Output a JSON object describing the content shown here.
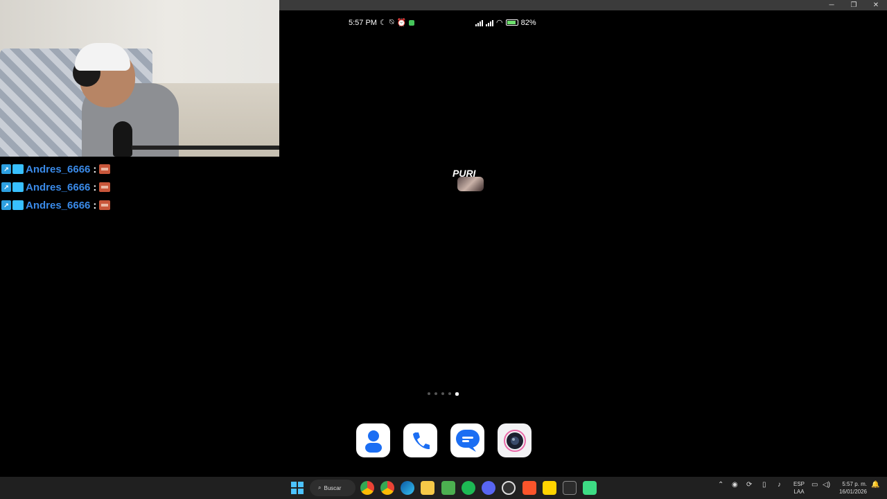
{
  "chat": {
    "messages": [
      {
        "user": "Andres_6666",
        "separator": ":"
      },
      {
        "user": "Andres_6666",
        "separator": ":"
      },
      {
        "user": "Andres_6666",
        "separator": ":"
      }
    ]
  },
  "window": {
    "minimize": "─",
    "restore": "❐",
    "close": "✕"
  },
  "phone_status": {
    "time": "5:57 PM",
    "battery": "82"
  },
  "widget": {
    "text": "PURI"
  },
  "home_pages": {
    "count": 5,
    "active": 5
  },
  "dock": {
    "apps": [
      "contacts-icon",
      "phone-icon",
      "messages-icon",
      "camera-icon"
    ]
  },
  "taskbar": {
    "search_label": "Buscar",
    "lang_primary": "ESP",
    "lang_secondary": "LAA",
    "clock_time": "5:57 p. m.",
    "clock_date": "16/01/2026",
    "colors": {
      "accent": "#3a8ae8",
      "background": "#202020"
    }
  }
}
